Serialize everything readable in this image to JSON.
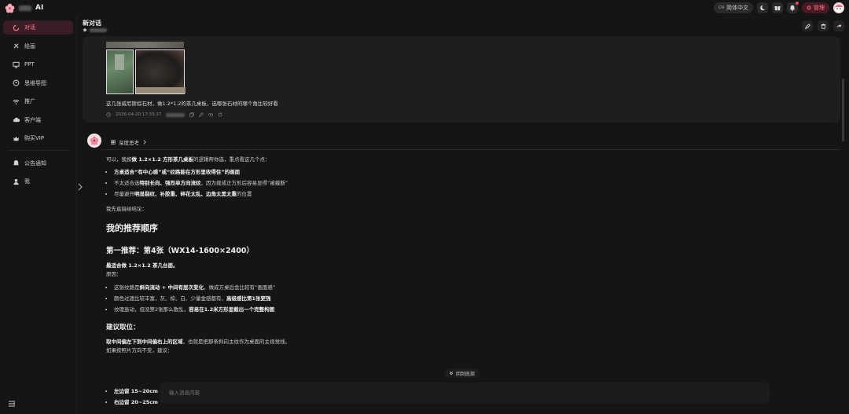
{
  "brand": {
    "name_suffix": "AI"
  },
  "topbar": {
    "lang_prefix": "CN",
    "lang_label": "简体中文",
    "admin_label": "管理"
  },
  "sidebar": {
    "items": [
      {
        "label": "对话",
        "icon": "chat-icon"
      },
      {
        "label": "绘画",
        "icon": "brush-icon"
      },
      {
        "label": "PPT",
        "icon": "presentation-icon"
      },
      {
        "label": "思维导图",
        "icon": "mindmap-icon"
      },
      {
        "label": "推广",
        "icon": "wifi-icon"
      },
      {
        "label": "客户端",
        "icon": "cloud-icon"
      },
      {
        "label": "购买VIP",
        "icon": "crown-icon"
      },
      {
        "label": "公告通知",
        "icon": "bell-icon"
      },
      {
        "label": "我",
        "icon": "user-icon"
      }
    ]
  },
  "chat": {
    "title": "新对话"
  },
  "user_message": {
    "text": "这几张威尼斯棕石材，做1.2*1.2的茶几桌板，选哪张石材的哪个角比较好看",
    "timestamp": "2026-04-20 17:33:37"
  },
  "assistant": {
    "think_label": "深度思考",
    "intro_pre": "可以，我按",
    "intro_bold": "做 1.2×1.2 方形茶几桌板",
    "intro_post": "的逻辑帮你选，重点看这几个点：",
    "points": [
      {
        "bold": "方桌适合“有中心感”或“纹路能在方形里收得住”的画面",
        "text": ""
      },
      {
        "pre": "不太适合选",
        "bold": "特别长向、强烈单方向流纹",
        "text": "，因为裁成正方形后容易显得“被截断”"
      },
      {
        "pre": "尽量避开",
        "bold": "明显裂纹、补胶重、碎花太乱、边角太黑太重",
        "text": "的位置"
      }
    ],
    "conclusion_lead": "我先直接给结论：",
    "h_recommend": "我的推荐顺序",
    "h_first": "第一推荐：第4张（WX14-1600×2400）",
    "first_bold": "最适合做 1.2×1.2 茶几台面。",
    "reason_label": "原因：",
    "reasons": [
      {
        "pre": "这张纹路是",
        "bold": "斜向流动 + 中间有层次变化",
        "text": "，做成方桌后会比较有“画面感”"
      },
      {
        "pre": "颜色过渡比较丰富，灰、棕、白、少量金感都有，",
        "bold": "高级感比第1张更强",
        "text": ""
      },
      {
        "pre": "纹理虽动，但没第2张那么散乱，",
        "bold": "容易在1.2米方形里截出一个完整构图",
        "text": ""
      }
    ],
    "h_position": "建议取位：",
    "position_bold": "取中间偏左下到中间偏右上的区域",
    "position_text": "，也就是把那条斜向主纹作为桌面的主视觉线。",
    "position_note": "如果按照片方向不变，建议：",
    "tail_items": [
      "左边留 15~20cm",
      "右边留 20~25cm"
    ]
  },
  "back_to_bottom": "回到底部",
  "input": {
    "placeholder": "输入消息内容"
  }
}
